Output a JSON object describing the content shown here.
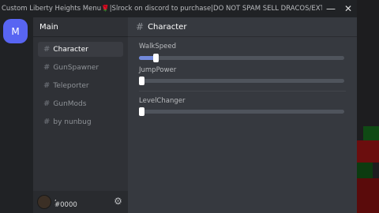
{
  "window": {
    "title": "Custom Liberty Heights Menu🌹|Slrock on discord to purchase|DO NOT SPAM SELL DRACOS/EXT",
    "minimize_glyph": "—",
    "close_glyph": "✕"
  },
  "server": {
    "initial": "M"
  },
  "guild": {
    "name": "Main"
  },
  "channels": [
    {
      "label": "Character",
      "active": true
    },
    {
      "label": "GunSpawner",
      "active": false
    },
    {
      "label": "Teleporter",
      "active": false
    },
    {
      "label": "GunMods",
      "active": false
    },
    {
      "label": "by nunbug",
      "active": false
    }
  ],
  "user": {
    "name": ",",
    "tag": "#0000",
    "settings_icon": "gear-icon"
  },
  "content": {
    "title": "Character",
    "sliders": [
      {
        "label": "WalkSpeed",
        "value_fraction": 0.07
      },
      {
        "label": "JumpPower",
        "value_fraction": 0.0
      },
      {
        "label": "LevelChanger",
        "value_fraction": 0.0
      }
    ]
  },
  "colors": {
    "accent": "#5865f2",
    "slider_fill": "#7289da"
  }
}
